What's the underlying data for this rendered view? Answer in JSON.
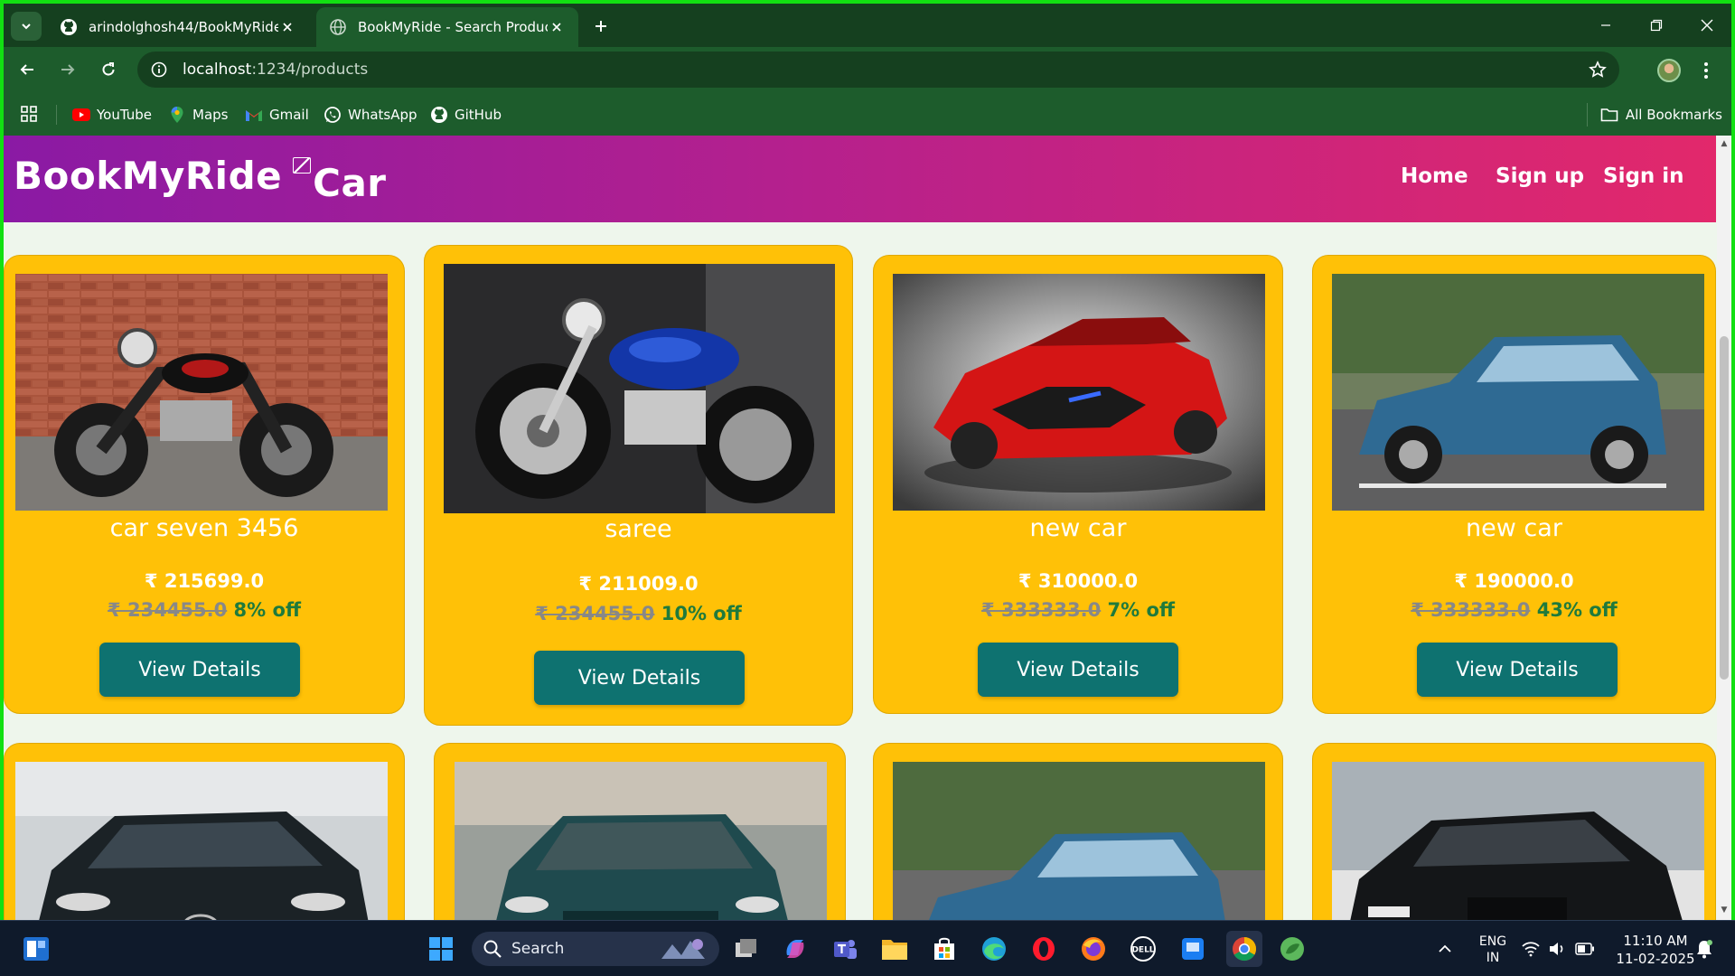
{
  "browser": {
    "tabs": [
      {
        "title": "arindolghosh44/BookMyRide",
        "icon": "github-icon",
        "active": false
      },
      {
        "title": "BookMyRide - Search Products",
        "icon": "globe-icon",
        "active": true
      }
    ],
    "url_host": "localhost",
    "url_path": ":1234/products",
    "bookmarks": [
      {
        "label": "YouTube",
        "icon": "youtube-icon"
      },
      {
        "label": "Maps",
        "icon": "maps-icon"
      },
      {
        "label": "Gmail",
        "icon": "gmail-icon"
      },
      {
        "label": "WhatsApp",
        "icon": "whatsapp-icon"
      },
      {
        "label": "GitHub",
        "icon": "github-icon"
      }
    ],
    "all_bookmarks": "All Bookmarks"
  },
  "site": {
    "brand": "BookMyRide",
    "brand_img_alt": "Car",
    "nav": {
      "home": "Home",
      "signup": "Sign up",
      "signin": "Sign in"
    },
    "colors": {
      "navbar_start": "#8a1aa4",
      "navbar_end": "#e2286b",
      "card": "#ffc107",
      "button": "#0e7270",
      "discount": "#1f7a3c"
    }
  },
  "products": [
    {
      "title": "car seven 3456",
      "price": "₹ 215699.0",
      "original_price": "₹ 234455.0",
      "discount": "8% off",
      "button": "View Details",
      "image": "motorcycle-retro-brick-wall"
    },
    {
      "title": "saree",
      "price": "₹ 211009.0",
      "original_price": "₹ 234455.0",
      "discount": "10% off",
      "button": "View Details",
      "image": "motorcycle-blue-cruiser"
    },
    {
      "title": "new car",
      "price": "₹ 310000.0",
      "original_price": "₹ 333333.0",
      "discount": "7% off",
      "button": "View Details",
      "image": "red-supercar"
    },
    {
      "title": "new car",
      "price": "₹ 190000.0",
      "original_price": "₹ 333333.0",
      "discount": "43% off",
      "button": "View Details",
      "image": "blue-hatchback"
    },
    {
      "image": "black-tata-car"
    },
    {
      "image": "teal-sedan"
    },
    {
      "image": "blue-hatchback-motion"
    },
    {
      "image": "black-tata-hatchback"
    }
  ],
  "taskbar": {
    "search_label": "Search",
    "language": "ENG",
    "region": "IN",
    "time": "11:10 AM",
    "date": "11-02-2025"
  }
}
